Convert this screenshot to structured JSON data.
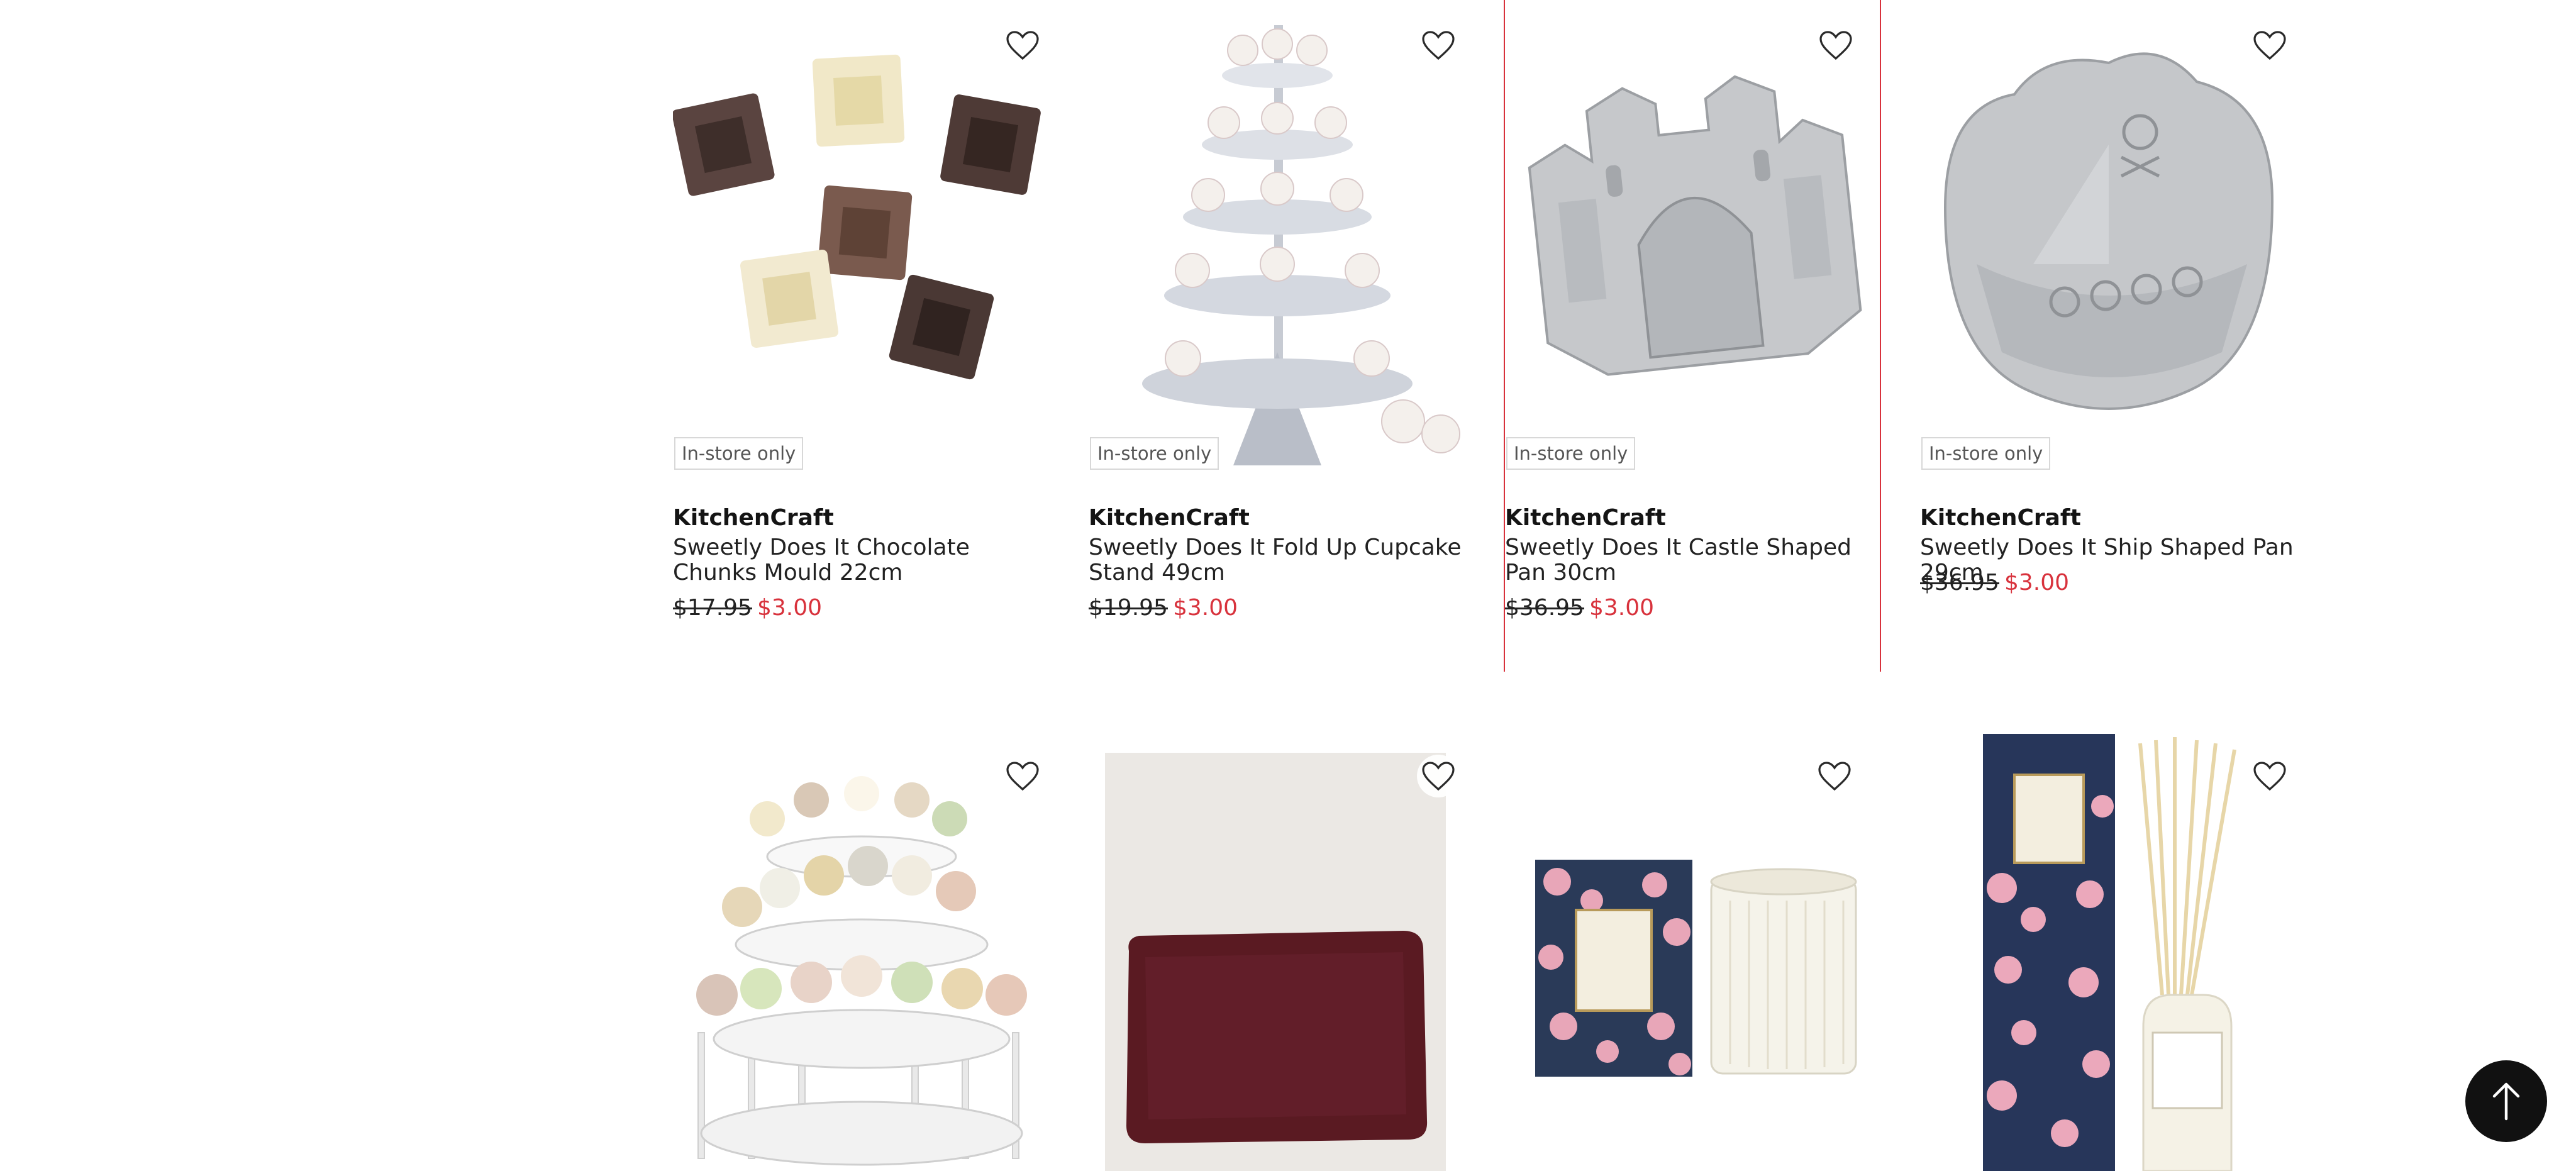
{
  "products": [
    {
      "badge": "In-store only",
      "brand": "KitchenCraft",
      "name": "Sweetly Does It Chocolate Chunks Mould 22cm",
      "old_price": "$17.95",
      "new_price": "$3.00"
    },
    {
      "badge": "In-store only",
      "brand": "KitchenCraft",
      "name": "Sweetly Does It Fold Up Cupcake Stand 49cm",
      "old_price": "$19.95",
      "new_price": "$3.00"
    },
    {
      "badge": "In-store only",
      "brand": "KitchenCraft",
      "name": "Sweetly Does It Castle Shaped Pan 30cm",
      "old_price": "$36.95",
      "new_price": "$3.00"
    },
    {
      "badge": "In-store only",
      "brand": "KitchenCraft",
      "name": "Sweetly Does It Ship Shaped Pan 29cm",
      "old_price": "$36.95",
      "new_price": "$3.00"
    }
  ],
  "icons": {
    "wishlist": "heart-outline-icon",
    "scroll_top": "arrow-up-icon"
  },
  "colors": {
    "sale_price": "#d8323c",
    "hover_outline": "#d8323c",
    "scroll_button": "#111111"
  }
}
